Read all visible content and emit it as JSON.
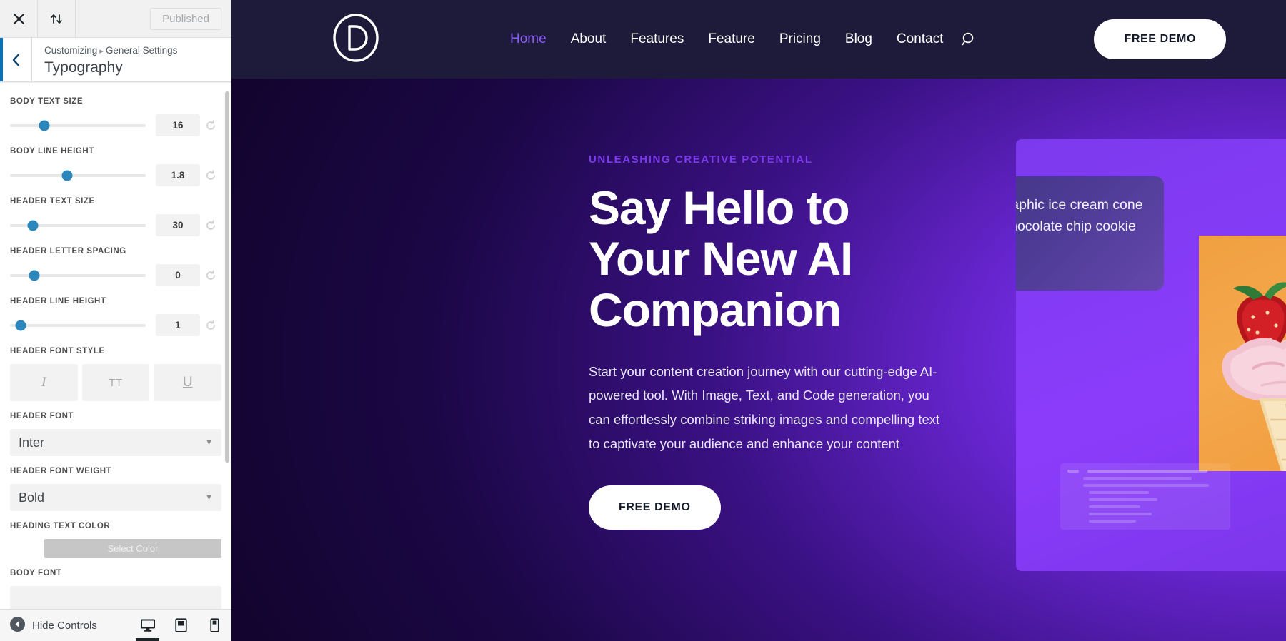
{
  "customizer": {
    "topbar": {
      "close_icon": "close-icon",
      "shortcuts_icon": "shortcuts-arrows-icon",
      "published_label": "Published"
    },
    "header": {
      "back_icon": "chevron-left-icon",
      "breadcrumb_root": "Customizing",
      "breadcrumb_separator": "▸",
      "breadcrumb_section": "General Settings",
      "panel_title": "Typography"
    },
    "controls": [
      {
        "type": "slider",
        "label": "Body Text Size",
        "value": "16",
        "knob_pct": 25,
        "reset_icon": "reset-arrow-icon"
      },
      {
        "type": "slider",
        "label": "Body Line Height",
        "value": "1.8",
        "knob_pct": 42,
        "reset_icon": "reset-arrow-icon"
      },
      {
        "type": "slider",
        "label": "Header Text Size",
        "value": "30",
        "knob_pct": 17,
        "reset_icon": "reset-arrow-icon"
      },
      {
        "type": "slider",
        "label": "Header Letter Spacing",
        "value": "0",
        "knob_pct": 18,
        "reset_icon": "reset-arrow-icon"
      },
      {
        "type": "slider",
        "label": "Header Line Height",
        "value": "1",
        "knob_pct": 8,
        "reset_icon": "reset-arrow-icon"
      }
    ],
    "font_style": {
      "label": "Header Font Style",
      "buttons": [
        {
          "name": "italic-button",
          "glyph": "I"
        },
        {
          "name": "uppercase-button",
          "glyph": "TT"
        },
        {
          "name": "underline-button",
          "glyph": "U"
        }
      ]
    },
    "header_font": {
      "label": "Header Font",
      "value": "Inter",
      "caret": "▼"
    },
    "header_font_weight": {
      "label": "Header Font Weight",
      "value": "Bold",
      "caret": "▼"
    },
    "heading_text_color": {
      "label": "Heading Text Color",
      "button_label": "Select Color"
    },
    "body_font": {
      "label": "Body Font"
    },
    "footer": {
      "hide_controls_label": "Hide Controls",
      "collapse_icon": "collapse-left-icon",
      "devices": [
        {
          "name": "desktop-preview-icon",
          "active": true
        },
        {
          "name": "tablet-preview-icon",
          "active": false
        },
        {
          "name": "mobile-preview-icon",
          "active": false
        }
      ]
    }
  },
  "site": {
    "header": {
      "logo_icon": "divi-d-logo-icon",
      "nav": [
        {
          "label": "Home",
          "active": true
        },
        {
          "label": "About",
          "active": false
        },
        {
          "label": "Features",
          "active": false
        },
        {
          "label": "Feature",
          "active": false
        },
        {
          "label": "Pricing",
          "active": false
        },
        {
          "label": "Blog",
          "active": false
        },
        {
          "label": "Contact",
          "active": false
        }
      ],
      "search_icon": "search-icon",
      "cta_label": "FREE DEMO"
    },
    "hero": {
      "eyebrow": "UNLEASHING CREATIVE POTENTIAL",
      "title_line1": "Say Hello to",
      "title_line2": "Your New AI",
      "title_line3": "Companion",
      "paragraph": "Start your content creation journey with our cutting-edge AI-powered tool. With Image, Text, and Code generation, you can effortlessly combine striking images and compelling text to captivate your audience and enhance your content",
      "cta_label": "FREE DEMO"
    },
    "visual": {
      "prompt_icon": "ai-sparkle-icon",
      "prompt_text": "Photographic ice cream cone with a chocolate chip cookie on top.",
      "image_alt": "ice-cream-cone-photo"
    },
    "colors": {
      "accent_purple": "#7c3aed",
      "bright_violet": "#8b3cfb",
      "header_navy": "#1e1b3a",
      "image_orange": "#f0a040",
      "sparkle_blue": "#4f7dfb",
      "sparkle_cyan": "#2ee6c5"
    }
  }
}
